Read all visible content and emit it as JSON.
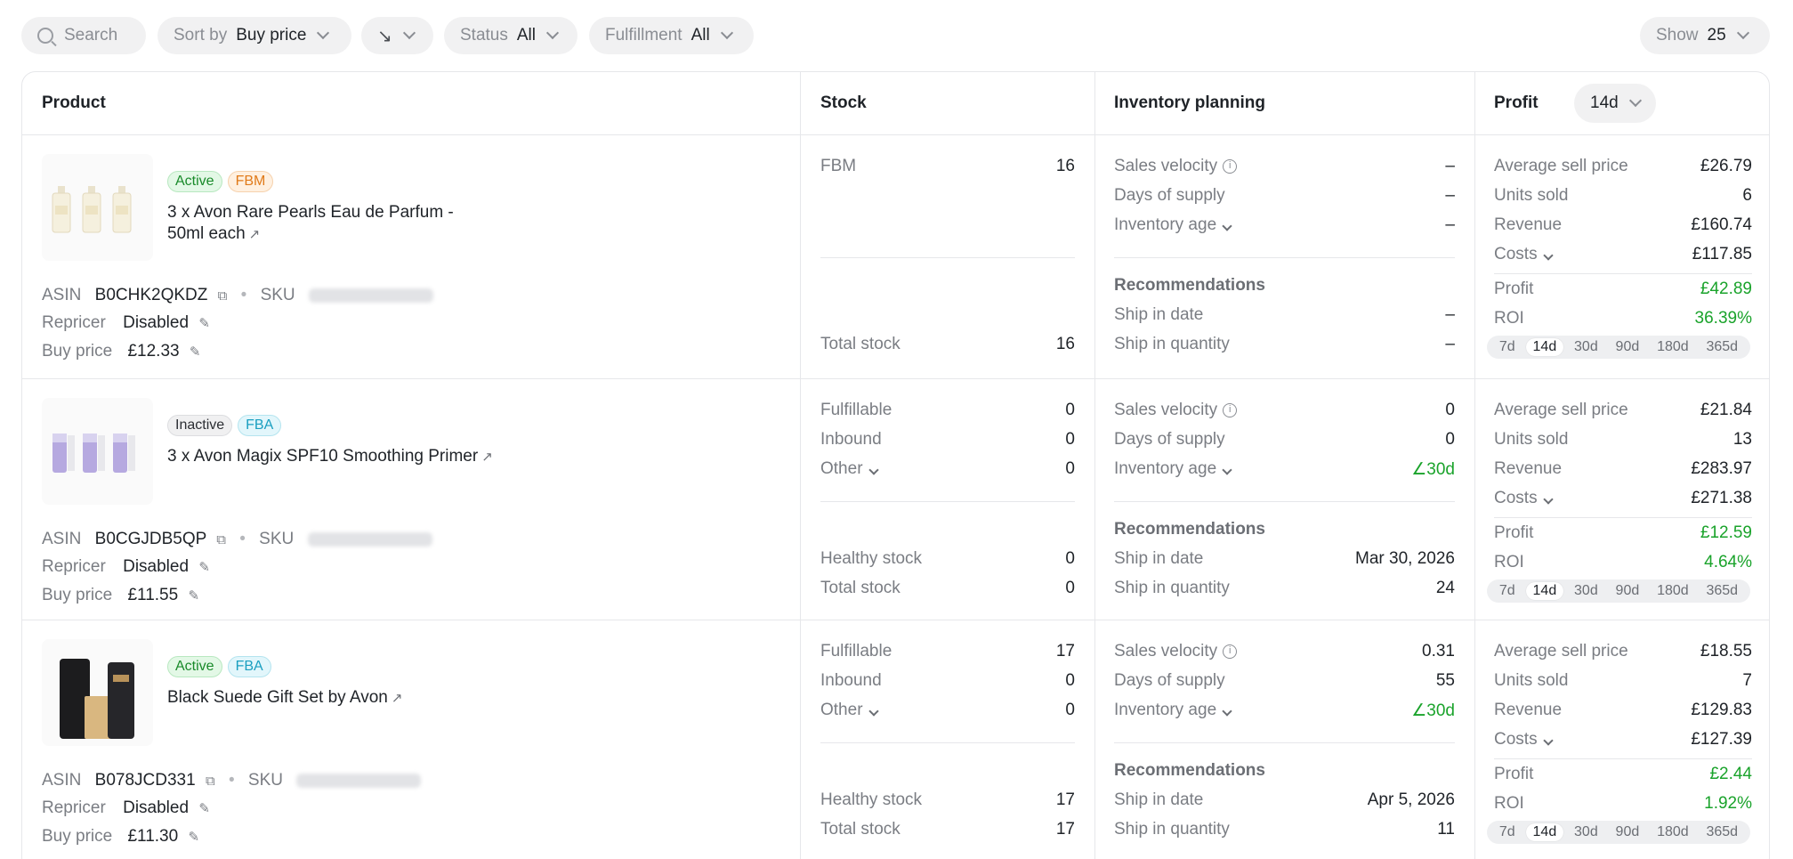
{
  "toolbar": {
    "search_placeholder": "Search",
    "sort_label": "Sort by",
    "sort_value": "Buy price",
    "direction_icon": "↘",
    "status_label": "Status",
    "status_value": "All",
    "fulfillment_label": "Fulfillment",
    "fulfillment_value": "All",
    "show_label": "Show",
    "show_value": "25"
  },
  "headers": {
    "product": "Product",
    "stock": "Stock",
    "inventory": "Inventory planning",
    "profit": "Profit",
    "profit_period": "14d"
  },
  "labels": {
    "asin": "ASIN",
    "sku": "SKU",
    "repricer": "Repricer",
    "buy_price": "Buy price",
    "sales_velocity": "Sales velocity",
    "days_of_supply": "Days of supply",
    "inventory_age": "Inventory age",
    "recommendations": "Recommendations",
    "ship_in_date": "Ship in date",
    "ship_in_quantity": "Ship in quantity",
    "avg_sell_price": "Average sell price",
    "units_sold": "Units sold",
    "revenue": "Revenue",
    "costs": "Costs",
    "profit": "Profit",
    "roi": "ROI",
    "fbm": "FBM",
    "fulfillable": "Fulfillable",
    "inbound": "Inbound",
    "other": "Other",
    "healthy_stock": "Healthy stock",
    "total_stock": "Total stock"
  },
  "periods": [
    "7d",
    "14d",
    "30d",
    "90d",
    "180d",
    "365d"
  ],
  "selected_period": "14d",
  "colors": {
    "green": "#1aa32b",
    "active_bg": "#e3f8e6",
    "fbm": "#e07a1a",
    "fba": "#1a9fc0"
  },
  "products": [
    {
      "status": "Active",
      "channel": "FBM",
      "name_line1": "3 x Avon Rare Pearls Eau de Parfum -",
      "name_line2": "50ml each",
      "asin": "B0CHK2QKDZ",
      "repricer": "Disabled",
      "buy_price": "£12.33",
      "stock": {
        "fbm": "16",
        "total": "16"
      },
      "inventory": {
        "sales_velocity": "–",
        "days_of_supply": "–",
        "inventory_age": "–",
        "ship_in_date": "–",
        "ship_in_quantity": "–"
      },
      "profit": {
        "avg_sell_price": "£26.79",
        "units_sold": "6",
        "revenue": "£160.74",
        "costs": "£117.85",
        "profit": "£42.89",
        "roi": "36.39%"
      }
    },
    {
      "status": "Inactive",
      "channel": "FBA",
      "name_line1": "3 x Avon Magix SPF10 Smoothing Primer",
      "name_line2": "",
      "asin": "B0CGJDB5QP",
      "repricer": "Disabled",
      "buy_price": "£11.55",
      "stock": {
        "fulfillable": "0",
        "inbound": "0",
        "other": "0",
        "healthy": "0",
        "total": "0"
      },
      "inventory": {
        "sales_velocity": "0",
        "days_of_supply": "0",
        "inventory_age": "∠30d",
        "ship_in_date": "Mar 30, 2026",
        "ship_in_quantity": "24"
      },
      "profit": {
        "avg_sell_price": "£21.84",
        "units_sold": "13",
        "revenue": "£283.97",
        "costs": "£271.38",
        "profit": "£12.59",
        "roi": "4.64%"
      }
    },
    {
      "status": "Active",
      "channel": "FBA",
      "name_line1": "Black Suede Gift Set by Avon",
      "name_line2": "",
      "asin": "B078JCD331",
      "repricer": "Disabled",
      "buy_price": "£11.30",
      "stock": {
        "fulfillable": "17",
        "inbound": "0",
        "other": "0",
        "healthy": "17",
        "total": "17"
      },
      "inventory": {
        "sales_velocity": "0.31",
        "days_of_supply": "55",
        "inventory_age": "∠30d",
        "ship_in_date": "Apr 5, 2026",
        "ship_in_quantity": "11"
      },
      "profit": {
        "avg_sell_price": "£18.55",
        "units_sold": "7",
        "revenue": "£129.83",
        "costs": "£127.39",
        "profit": "£2.44",
        "roi": "1.92%"
      }
    }
  ]
}
